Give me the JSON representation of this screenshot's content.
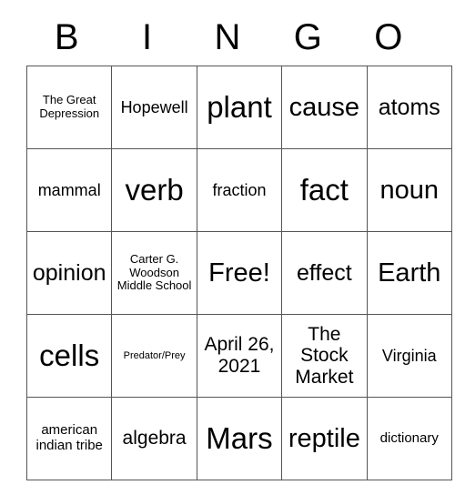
{
  "card": {
    "header_letters": [
      "B",
      "I",
      "N",
      "G",
      "O"
    ],
    "rows": [
      [
        {
          "text": "The Great Depression",
          "size": "sm"
        },
        {
          "text": "Hopewell",
          "size": "lg"
        },
        {
          "text": "plant",
          "size": "mega"
        },
        {
          "text": "cause",
          "size": "huge"
        },
        {
          "text": "atoms",
          "size": "xxl"
        }
      ],
      [
        {
          "text": "mammal",
          "size": "lg"
        },
        {
          "text": "verb",
          "size": "mega"
        },
        {
          "text": "fraction",
          "size": "lg"
        },
        {
          "text": "fact",
          "size": "mega"
        },
        {
          "text": "noun",
          "size": "huge"
        }
      ],
      [
        {
          "text": "opinion",
          "size": "xxl"
        },
        {
          "text": "Carter G. Woodson Middle School",
          "size": "sm"
        },
        {
          "text": "Free!",
          "size": "huge"
        },
        {
          "text": "effect",
          "size": "xxl"
        },
        {
          "text": "Earth",
          "size": "huge"
        }
      ],
      [
        {
          "text": "cells",
          "size": "mega"
        },
        {
          "text": "Predator/Prey",
          "size": "xs"
        },
        {
          "text": "April 26, 2021",
          "size": "xl"
        },
        {
          "text": "The Stock Market",
          "size": "xl"
        },
        {
          "text": "Virginia",
          "size": "lg"
        }
      ],
      [
        {
          "text": "american indian tribe",
          "size": "md"
        },
        {
          "text": "algebra",
          "size": "xl"
        },
        {
          "text": "Mars",
          "size": "mega"
        },
        {
          "text": "reptile",
          "size": "huge"
        },
        {
          "text": "dictionary",
          "size": "md"
        }
      ]
    ],
    "free_space": {
      "row": 2,
      "col": 2,
      "label": "Free!"
    },
    "colors": {
      "background": "#ffffff",
      "text": "#000000",
      "grid_line": "#555555"
    }
  }
}
